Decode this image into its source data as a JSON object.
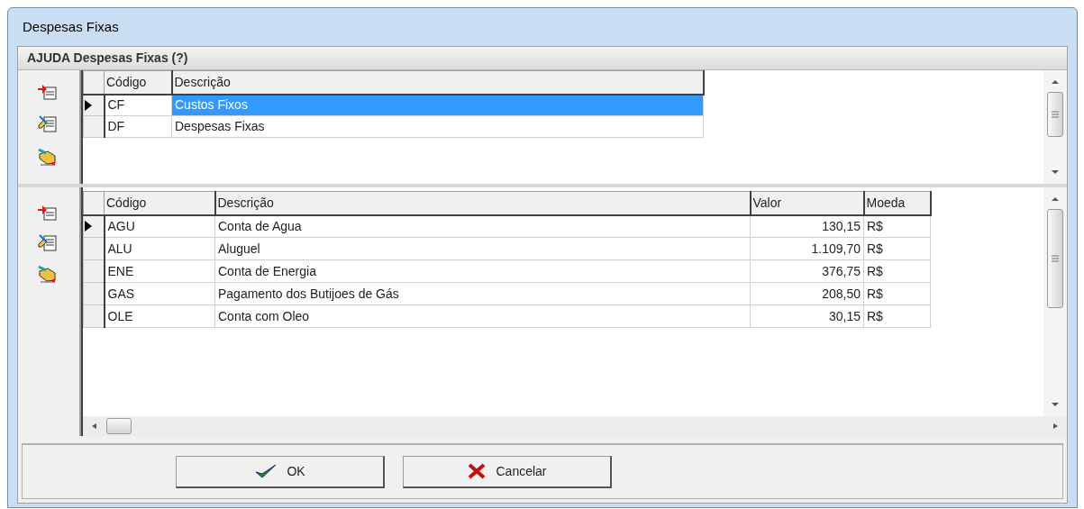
{
  "window": {
    "title": "Despesas Fixas"
  },
  "panel": {
    "title": "AJUDA Despesas Fixas (?)"
  },
  "groups_table": {
    "columns": [
      "Código",
      "Descrição"
    ],
    "rows": [
      {
        "selected": true,
        "cells": [
          "CF",
          "Custos Fixos"
        ]
      },
      {
        "selected": false,
        "cells": [
          "DF",
          "Despesas Fixas"
        ]
      }
    ]
  },
  "expenses_table": {
    "columns": [
      "Código",
      "Descrição",
      "Valor",
      "Moeda"
    ],
    "rows": [
      {
        "selected": true,
        "cells": [
          "AGU",
          "Conta de Agua",
          "130,15",
          "R$"
        ]
      },
      {
        "selected": false,
        "cells": [
          "ALU",
          "Aluguel",
          "1.109,70",
          "R$"
        ]
      },
      {
        "selected": false,
        "cells": [
          "ENE",
          "Conta de Energia",
          "376,75",
          "R$"
        ]
      },
      {
        "selected": false,
        "cells": [
          "GAS",
          "Pagamento dos Butijoes de Gás",
          "208,50",
          "R$"
        ]
      },
      {
        "selected": false,
        "cells": [
          "OLE",
          "Conta com Oleo",
          "30,15",
          "R$"
        ]
      }
    ]
  },
  "buttons": [
    {
      "kind": "ok",
      "label": "OK"
    },
    {
      "kind": "cancel",
      "label": "Cancelar"
    }
  ]
}
